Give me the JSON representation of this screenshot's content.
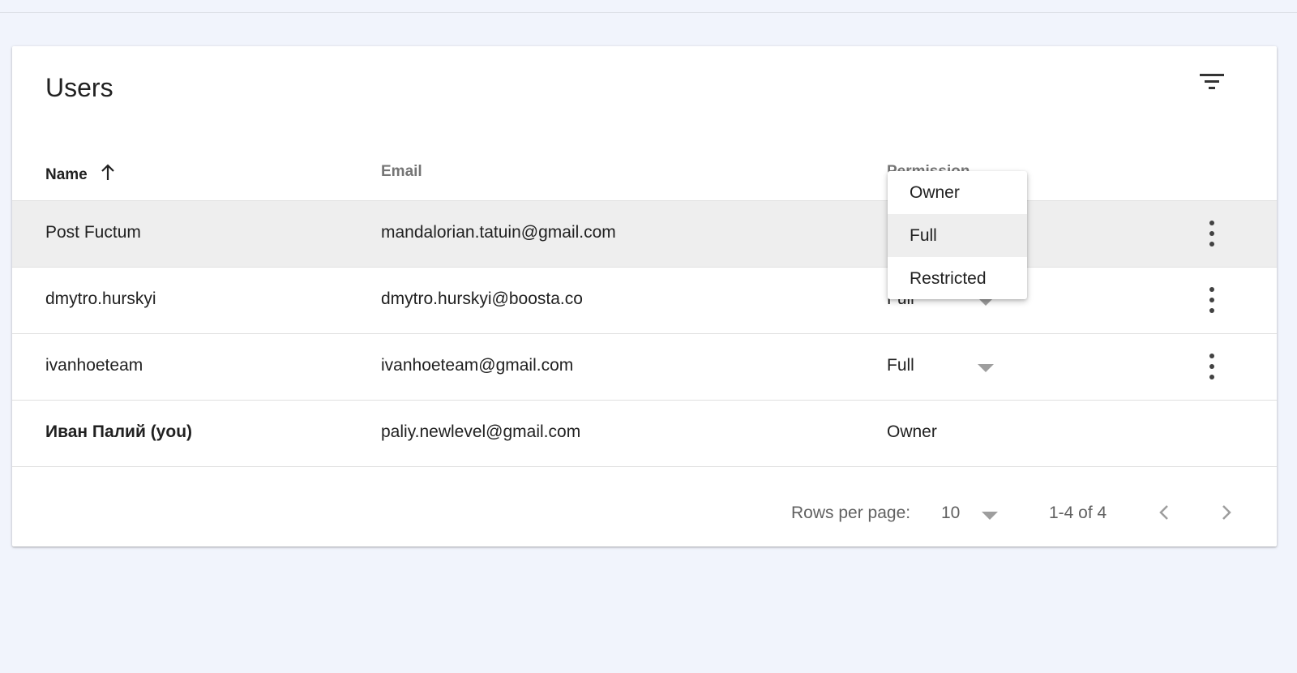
{
  "card": {
    "title": "Users"
  },
  "table": {
    "headers": {
      "name": "Name",
      "email": "Email",
      "permission": "Permission"
    },
    "rows": [
      {
        "name": "Post Fuctum",
        "email": "mandalorian.tatuin@gmail.com",
        "permission": ""
      },
      {
        "name": "dmytro.hurskyi",
        "email": "dmytro.hurskyi@boosta.co",
        "permission": "Full"
      },
      {
        "name": "ivanhoeteam",
        "email": "ivanhoeteam@gmail.com",
        "permission": "Full"
      },
      {
        "name": "Иван Палий (you)",
        "email": "paliy.newlevel@gmail.com",
        "permission": "Owner"
      }
    ]
  },
  "dropdown": {
    "options": [
      "Owner",
      "Full",
      "Restricted"
    ],
    "highlighted": "Full"
  },
  "pagination": {
    "rows_label": "Rows per page:",
    "rows_value": "10",
    "range": "1-4 of 4"
  },
  "icons": {
    "filter": "filter-list-icon",
    "sort": "arrow-up-icon",
    "row_menu": "more-vert-icon",
    "prev": "chevron-left-icon",
    "next": "chevron-right-icon"
  },
  "colors": {
    "background": "#f1f4fc",
    "card": "#ffffff",
    "row_highlight": "#eeeeee"
  }
}
